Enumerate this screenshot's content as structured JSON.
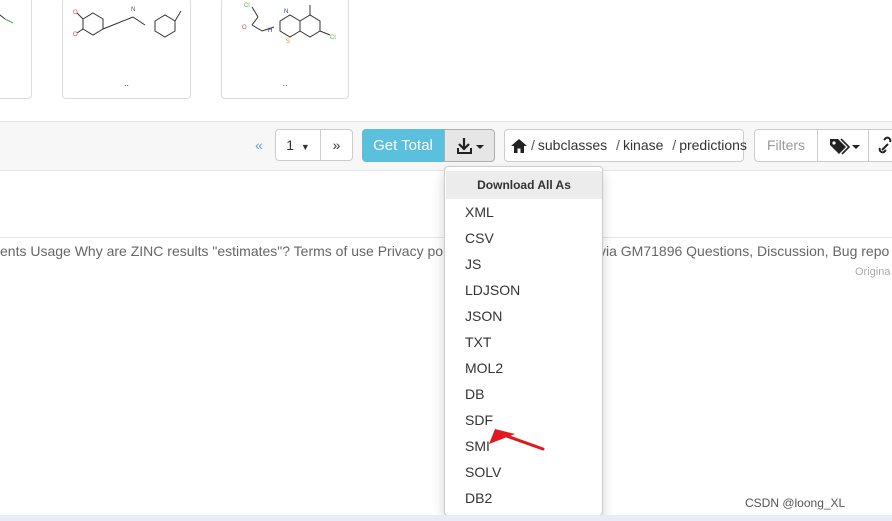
{
  "cards": [
    {
      "label": ""
    },
    {
      "label": ".."
    },
    {
      "label": ".."
    }
  ],
  "pagination": {
    "prev": "«",
    "page": "1",
    "next": "»"
  },
  "toolbar": {
    "get_total": "Get Total",
    "breadcrumb": [
      "subclasses",
      "kinase",
      "predictions"
    ],
    "filters": "Filters"
  },
  "footer": {
    "left": "ents Usage Why are ZINC results \"estimates\"? Terms of use Privacy pol",
    "right": "via GM71896 Questions, Discussion, Bug repo",
    "original": "Origina"
  },
  "download_menu": {
    "header": "Download All As",
    "items": [
      "XML",
      "CSV",
      "JS",
      "LDJSON",
      "JSON",
      "TXT",
      "MOL2",
      "DB",
      "SDF",
      "SMI",
      "SOLV",
      "DB2"
    ]
  },
  "annotation": {
    "arrow_color": "#e0191f",
    "points_to": "SMI"
  },
  "watermark": "CSDN @loong_XL"
}
